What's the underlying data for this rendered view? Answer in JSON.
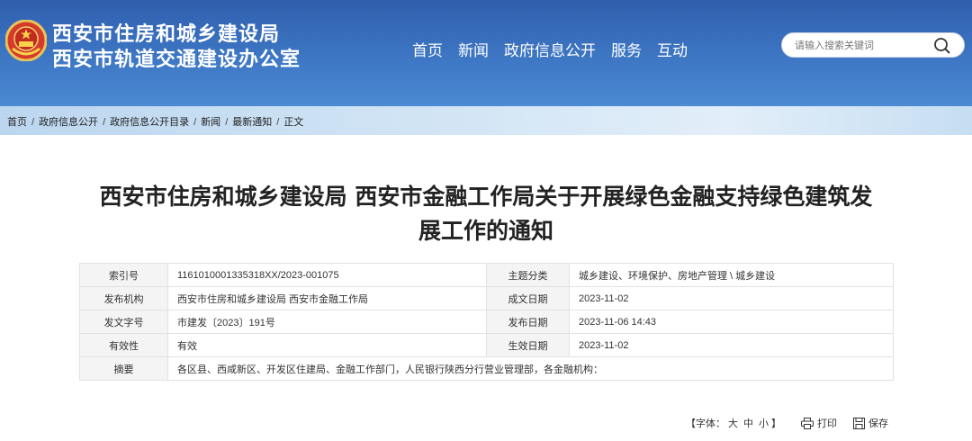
{
  "header": {
    "org_line1": "西安市住房和城乡建设局",
    "org_line2": "西安市轨道交通建设办公室",
    "nav": [
      "首页",
      "新闻",
      "政府信息公开",
      "服务",
      "互动"
    ],
    "search_placeholder": "请输入搜索关键词",
    "bg_color": "#3a6fbd"
  },
  "breadcrumb": {
    "items": [
      "首页",
      "政府信息公开",
      "政府信息公开目录",
      "新闻",
      "最新通知",
      "正文"
    ],
    "separator": "/"
  },
  "article": {
    "title_line1": "西安市住房和城乡建设局 西安市金融工作局关于开展绿色金融支持绿色建筑发",
    "title_line2": "展工作的通知"
  },
  "meta": {
    "rows": [
      {
        "k1": "索引号",
        "v1": "1161010001335318XX/2023-001075",
        "k2": "主题分类",
        "v2": "城乡建设、环境保护、房地产管理 \\ 城乡建设"
      },
      {
        "k1": "发布机构",
        "v1": "西安市住房和城乡建设局 西安市金融工作局",
        "k2": "成文日期",
        "v2": "2023-11-02"
      },
      {
        "k1": "发文字号",
        "v1": "市建发〔2023〕191号",
        "k2": "发布日期",
        "v2": "2023-11-06 14:43"
      },
      {
        "k1": "有效性",
        "v1": "有效",
        "k2": "生效日期",
        "v2": "2023-11-02"
      }
    ],
    "summary_label": "摘要",
    "summary_value": "各区县、西咸新区、开发区住建局、金融工作部门，人民银行陕西分行营业管理部，各金融机构："
  },
  "tools": {
    "font_label_open": "【字体：",
    "font_large": "大",
    "font_medium": "中",
    "font_small": "小",
    "font_label_close": "】",
    "print_label": "打印",
    "save_label": "保存"
  }
}
